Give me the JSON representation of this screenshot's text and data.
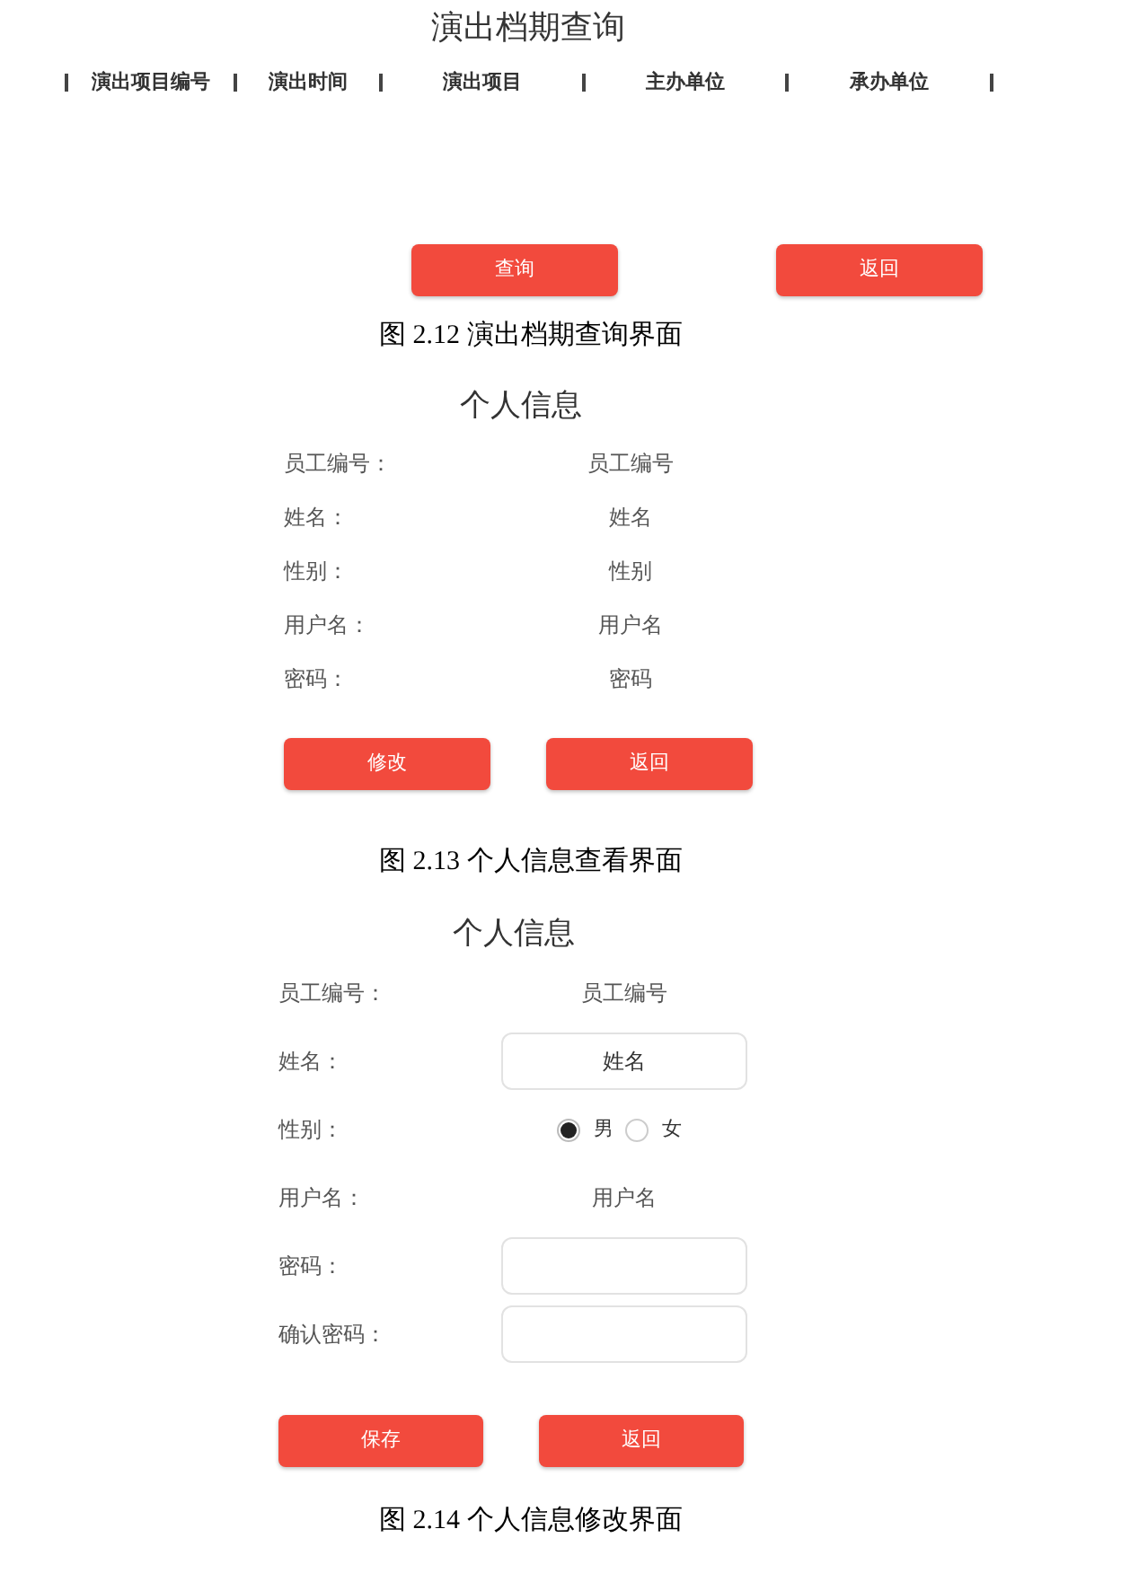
{
  "figures": [
    {
      "kind": "schedule_query",
      "title": "演出档期查询",
      "table": {
        "columns": [
          "演出项目编号",
          "演出时间",
          "演出项目",
          "主办单位",
          "承办单位"
        ]
      },
      "buttons": [
        "查询",
        "返回"
      ],
      "caption": "图 2.12 演出档期查询界面"
    },
    {
      "kind": "profile_view",
      "title": "个人信息",
      "fields": [
        {
          "label": "员工编号：",
          "value": "员工编号"
        },
        {
          "label": "姓名：",
          "value": "姓名"
        },
        {
          "label": "性别：",
          "value": "性别"
        },
        {
          "label": "用户名：",
          "value": "用户名"
        },
        {
          "label": "密码：",
          "value": "密码"
        }
      ],
      "buttons": [
        "修改",
        "返回"
      ],
      "caption": "图 2.13 个人信息查看界面"
    },
    {
      "kind": "profile_edit",
      "title": "个人信息",
      "fields": [
        {
          "kind": "text",
          "label": "员工编号：",
          "value": "员工编号"
        },
        {
          "kind": "input",
          "label": "姓名：",
          "value": "姓名"
        },
        {
          "kind": "radio",
          "label": "性别：",
          "options": [
            {
              "label": "男",
              "selected": true
            },
            {
              "label": "女",
              "selected": false
            }
          ]
        },
        {
          "kind": "text",
          "label": "用户名：",
          "value": "用户名"
        },
        {
          "kind": "input",
          "label": "密码："
        },
        {
          "kind": "input",
          "label": "确认密码："
        }
      ],
      "buttons": [
        "保存",
        "返回"
      ],
      "caption": "图 2.14 个人信息修改界面"
    }
  ]
}
